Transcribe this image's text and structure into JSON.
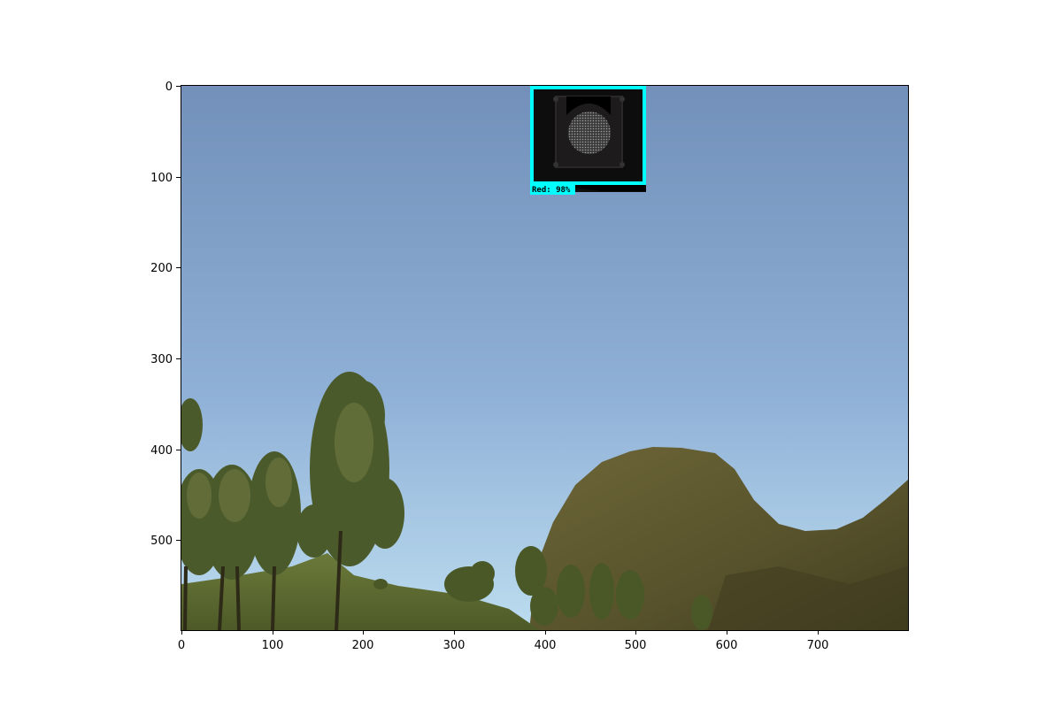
{
  "figure": {
    "image_description_elements": [
      "sky",
      "tree-cluster-left",
      "grass-hill-left",
      "bushes-center",
      "olive-hill-right",
      "traffic-light"
    ],
    "x_ticks": [
      "0",
      "100",
      "200",
      "300",
      "400",
      "500",
      "600",
      "700"
    ],
    "y_ticks": [
      "0",
      "100",
      "200",
      "300",
      "400",
      "500"
    ],
    "detection": {
      "label": "Red:  98%",
      "box_color": "#00ffff"
    },
    "colors": {
      "sky_top": "#7491ba",
      "sky_bottom": "#b6d6ec",
      "hill": "#5b5530",
      "grass": "#5a6a32",
      "tree": "#4d5b2b"
    }
  }
}
